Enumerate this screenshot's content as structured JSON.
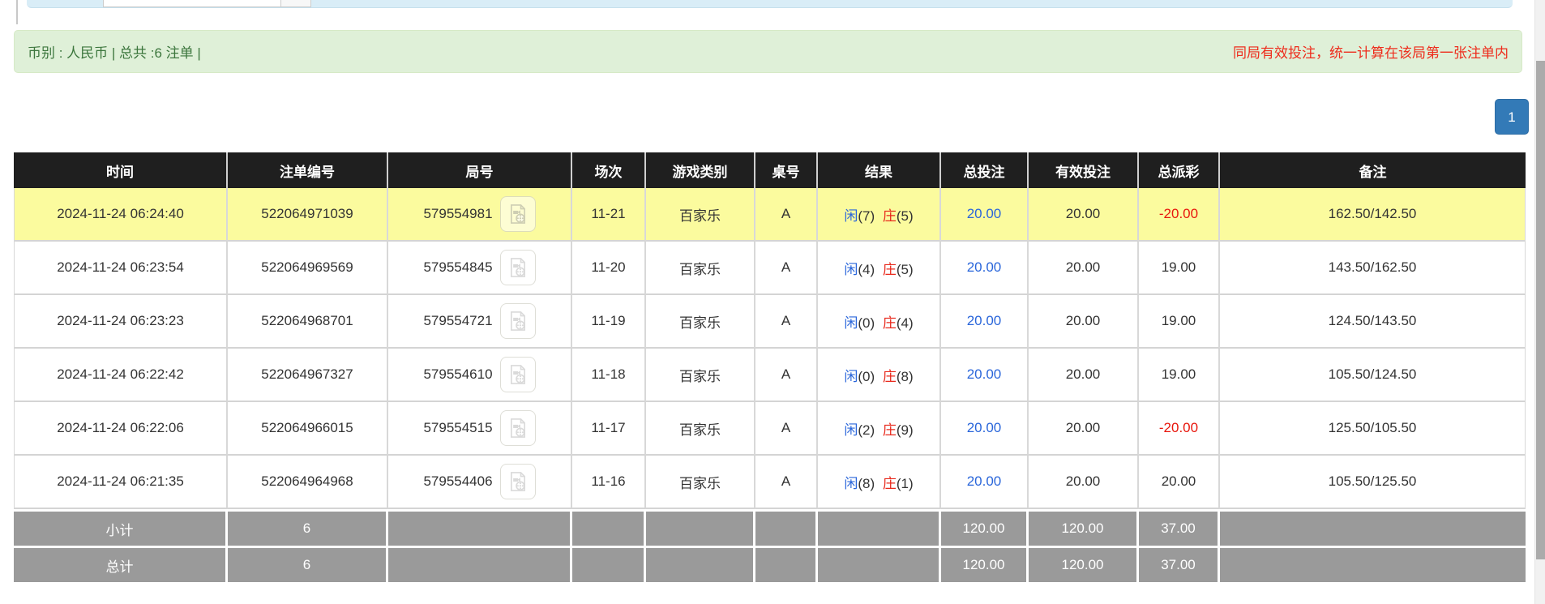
{
  "summary_bar": {
    "left": "币别 : 人民币 | 总共 :6 注单 |",
    "right": "同局有效投注，统一计算在该局第一张注单内"
  },
  "pagination": {
    "current": "1"
  },
  "table": {
    "columns": [
      "时间",
      "注单编号",
      "局号",
      "场次",
      "游戏类别",
      "桌号",
      "结果",
      "总投注",
      "有效投注",
      "总派彩",
      "备注"
    ],
    "rows": [
      {
        "time": "2024-11-24 06:24:40",
        "bet_id": "522064971039",
        "round_id": "579554981",
        "session": "11-21",
        "game": "百家乐",
        "table_no": "A",
        "result": {
          "player": "闲",
          "player_score": "(7)",
          "banker": "庄",
          "banker_score": "(5)"
        },
        "total_bet": "20.00",
        "valid_bet": "20.00",
        "payout": "-20.00",
        "remark": "162.50/142.50"
      },
      {
        "time": "2024-11-24 06:23:54",
        "bet_id": "522064969569",
        "round_id": "579554845",
        "session": "11-20",
        "game": "百家乐",
        "table_no": "A",
        "result": {
          "player": "闲",
          "player_score": "(4)",
          "banker": "庄",
          "banker_score": "(5)"
        },
        "total_bet": "20.00",
        "valid_bet": "20.00",
        "payout": "19.00",
        "remark": "143.50/162.50"
      },
      {
        "time": "2024-11-24 06:23:23",
        "bet_id": "522064968701",
        "round_id": "579554721",
        "session": "11-19",
        "game": "百家乐",
        "table_no": "A",
        "result": {
          "player": "闲",
          "player_score": "(0)",
          "banker": "庄",
          "banker_score": "(4)"
        },
        "total_bet": "20.00",
        "valid_bet": "20.00",
        "payout": "19.00",
        "remark": "124.50/143.50"
      },
      {
        "time": "2024-11-24 06:22:42",
        "bet_id": "522064967327",
        "round_id": "579554610",
        "session": "11-18",
        "game": "百家乐",
        "table_no": "A",
        "result": {
          "player": "闲",
          "player_score": "(0)",
          "banker": "庄",
          "banker_score": "(8)"
        },
        "total_bet": "20.00",
        "valid_bet": "20.00",
        "payout": "19.00",
        "remark": "105.50/124.50"
      },
      {
        "time": "2024-11-24 06:22:06",
        "bet_id": "522064966015",
        "round_id": "579554515",
        "session": "11-17",
        "game": "百家乐",
        "table_no": "A",
        "result": {
          "player": "闲",
          "player_score": "(2)",
          "banker": "庄",
          "banker_score": "(9)"
        },
        "total_bet": "20.00",
        "valid_bet": "20.00",
        "payout": "-20.00",
        "remark": "125.50/105.50"
      },
      {
        "time": "2024-11-24 06:21:35",
        "bet_id": "522064964968",
        "round_id": "579554406",
        "session": "11-16",
        "game": "百家乐",
        "table_no": "A",
        "result": {
          "player": "闲",
          "player_score": "(8)",
          "banker": "庄",
          "banker_score": "(1)"
        },
        "total_bet": "20.00",
        "valid_bet": "20.00",
        "payout": "20.00",
        "remark": "105.50/125.50"
      }
    ],
    "subtotal": {
      "label": "小计",
      "count": "6",
      "total_bet": "120.00",
      "valid_bet": "120.00",
      "payout": "37.00"
    },
    "total": {
      "label": "总计",
      "count": "6",
      "total_bet": "120.00",
      "valid_bet": "120.00",
      "payout": "37.00"
    }
  },
  "icons": {
    "round_replay": "video-replay-icon"
  },
  "colors": {
    "header_bg": "#1f1f1f",
    "highlight_row": "#fbfb9e",
    "footer_bg": "#9a9a9a",
    "link_blue": "#2a66da",
    "loss_red": "#e8160c",
    "banker_red": "#e8291c",
    "summary_bg": "#dff0d8",
    "summary_text": "#3c763d",
    "notice_red": "#ee2c1c",
    "pagination_blue": "#337ab7"
  }
}
